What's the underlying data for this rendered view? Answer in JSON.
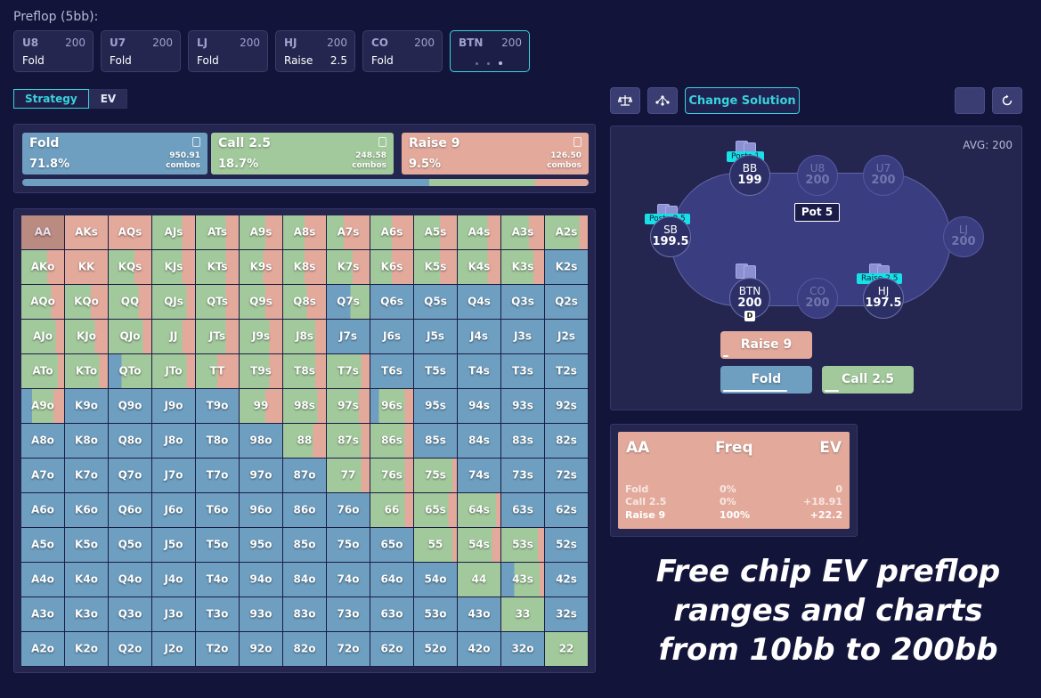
{
  "header": {
    "action_title": "Preflop (5bb):",
    "positions": [
      {
        "name": "U8",
        "stack": "200",
        "action": "Fold",
        "amount": ""
      },
      {
        "name": "U7",
        "stack": "200",
        "action": "Fold",
        "amount": ""
      },
      {
        "name": "LJ",
        "stack": "200",
        "action": "Fold",
        "amount": ""
      },
      {
        "name": "HJ",
        "stack": "200",
        "action": "Raise",
        "amount": "2.5"
      },
      {
        "name": "CO",
        "stack": "200",
        "action": "Fold",
        "amount": ""
      },
      {
        "name": "BTN",
        "stack": "200",
        "action": "",
        "amount": "",
        "active": true
      }
    ]
  },
  "tabs": {
    "strategy": "Strategy",
    "ev": "EV"
  },
  "colors": {
    "fold": "#6e9fc1",
    "call": "#a2c99c",
    "raise": "#e3aa9c",
    "accent": "#38d3dc",
    "background": "#13143a"
  },
  "summary": [
    {
      "label": "Fold",
      "pct": "71.8%",
      "combos": "950.91",
      "combos_label": "combos",
      "color": "#6e9fc1"
    },
    {
      "label": "Call 2.5",
      "pct": "18.7%",
      "combos": "248.58",
      "combos_label": "combos",
      "color": "#a2c99c"
    },
    {
      "label": "Raise 9",
      "pct": "9.5%",
      "combos": "126.50",
      "combos_label": "combos",
      "color": "#e3aa9c"
    }
  ],
  "summary_bar": {
    "fold": 71.8,
    "call": 18.7,
    "raise": 9.5
  },
  "grid": {
    "rows": [
      [
        "AA",
        "AKs",
        "AQs",
        "AJs",
        "ATs",
        "A9s",
        "A8s",
        "A7s",
        "A6s",
        "A5s",
        "A4s",
        "A3s",
        "A2s"
      ],
      [
        "AKo",
        "KK",
        "KQs",
        "KJs",
        "KTs",
        "K9s",
        "K8s",
        "K7s",
        "K6s",
        "K5s",
        "K4s",
        "K3s",
        "K2s"
      ],
      [
        "AQo",
        "KQo",
        "QQ",
        "QJs",
        "QTs",
        "Q9s",
        "Q8s",
        "Q7s",
        "Q6s",
        "Q5s",
        "Q4s",
        "Q3s",
        "Q2s"
      ],
      [
        "AJo",
        "KJo",
        "QJo",
        "JJ",
        "JTs",
        "J9s",
        "J8s",
        "J7s",
        "J6s",
        "J5s",
        "J4s",
        "J3s",
        "J2s"
      ],
      [
        "ATo",
        "KTo",
        "QTo",
        "JTo",
        "TT",
        "T9s",
        "T8s",
        "T7s",
        "T6s",
        "T5s",
        "T4s",
        "T3s",
        "T2s"
      ],
      [
        "A9o",
        "K9o",
        "Q9o",
        "J9o",
        "T9o",
        "99",
        "98s",
        "97s",
        "96s",
        "95s",
        "94s",
        "93s",
        "92s"
      ],
      [
        "A8o",
        "K8o",
        "Q8o",
        "J8o",
        "T8o",
        "98o",
        "88",
        "87s",
        "86s",
        "85s",
        "84s",
        "83s",
        "82s"
      ],
      [
        "A7o",
        "K7o",
        "Q7o",
        "J7o",
        "T7o",
        "97o",
        "87o",
        "77",
        "76s",
        "75s",
        "74s",
        "73s",
        "72s"
      ],
      [
        "A6o",
        "K6o",
        "Q6o",
        "J6o",
        "T6o",
        "96o",
        "86o",
        "76o",
        "66",
        "65s",
        "64s",
        "63s",
        "62s"
      ],
      [
        "A5o",
        "K5o",
        "Q5o",
        "J5o",
        "T5o",
        "95o",
        "85o",
        "75o",
        "65o",
        "55",
        "54s",
        "53s",
        "52s"
      ],
      [
        "A4o",
        "K4o",
        "Q4o",
        "J4o",
        "T4o",
        "94o",
        "84o",
        "74o",
        "64o",
        "54o",
        "44",
        "43s",
        "42s"
      ],
      [
        "A3o",
        "K3o",
        "Q3o",
        "J3o",
        "T3o",
        "93o",
        "83o",
        "73o",
        "63o",
        "53o",
        "43o",
        "33",
        "32s"
      ],
      [
        "A2o",
        "K2o",
        "Q2o",
        "J2o",
        "T2o",
        "92o",
        "82o",
        "72o",
        "62o",
        "52o",
        "42o",
        "32o",
        "22"
      ]
    ],
    "strategy": {
      "AA": [
        0,
        0,
        1
      ],
      "AKs": [
        0,
        0,
        1
      ],
      "AQs": [
        0,
        0,
        1
      ],
      "AJs": [
        0,
        0.7,
        0.3
      ],
      "ATs": [
        0,
        0.7,
        0.3
      ],
      "A9s": [
        0,
        0.6,
        0.4
      ],
      "A8s": [
        0,
        0.5,
        0.5
      ],
      "A7s": [
        0,
        0.4,
        0.6
      ],
      "A6s": [
        0,
        0.5,
        0.5
      ],
      "A5s": [
        0,
        0.6,
        0.4
      ],
      "A4s": [
        0,
        0.7,
        0.3
      ],
      "A3s": [
        0,
        0.65,
        0.35
      ],
      "A2s": [
        0,
        0.8,
        0.2
      ],
      "AKo": [
        0,
        0.6,
        0.4
      ],
      "KK": [
        0,
        0,
        1
      ],
      "KQs": [
        0,
        0.6,
        0.4
      ],
      "KJs": [
        0,
        0.7,
        0.3
      ],
      "KTs": [
        0,
        0.7,
        0.3
      ],
      "K9s": [
        0,
        0.55,
        0.45
      ],
      "K8s": [
        0,
        0.5,
        0.5
      ],
      "K7s": [
        0,
        0.6,
        0.4
      ],
      "K6s": [
        0,
        0.5,
        0.5
      ],
      "K5s": [
        0,
        0.6,
        0.4
      ],
      "K4s": [
        0,
        0.7,
        0.3
      ],
      "K3s": [
        0,
        0.75,
        0.25
      ],
      "K2s": [
        1,
        0,
        0
      ],
      "AQo": [
        0,
        0.7,
        0.3
      ],
      "KQo": [
        0,
        0.6,
        0.4
      ],
      "QQ": [
        0,
        0.7,
        0.3
      ],
      "QJs": [
        0,
        0.8,
        0.2
      ],
      "QTs": [
        0,
        0.7,
        0.3
      ],
      "Q9s": [
        0,
        0.6,
        0.4
      ],
      "Q8s": [
        0,
        0.55,
        0.45
      ],
      "Q7s": [
        0.55,
        0.45,
        0
      ],
      "Q6s": [
        1,
        0,
        0
      ],
      "Q5s": [
        1,
        0,
        0
      ],
      "Q4s": [
        1,
        0,
        0
      ],
      "Q3s": [
        1,
        0,
        0
      ],
      "Q2s": [
        1,
        0,
        0
      ],
      "AJo": [
        0,
        0.8,
        0.2
      ],
      "KJo": [
        0,
        0.7,
        0.3
      ],
      "QJo": [
        0,
        0.8,
        0.2
      ],
      "JJ": [
        0,
        0.7,
        0.3
      ],
      "JTs": [
        0,
        0.7,
        0.3
      ],
      "J9s": [
        0,
        0.7,
        0.3
      ],
      "J8s": [
        0,
        0.75,
        0.25
      ],
      "J7s": [
        1,
        0,
        0
      ],
      "J6s": [
        1,
        0,
        0
      ],
      "J5s": [
        1,
        0,
        0
      ],
      "J4s": [
        1,
        0,
        0
      ],
      "J3s": [
        1,
        0,
        0
      ],
      "J2s": [
        1,
        0,
        0
      ],
      "ATo": [
        0,
        0.85,
        0.15
      ],
      "KTo": [
        0,
        0.8,
        0.2
      ],
      "QTo": [
        0.3,
        0.7,
        0
      ],
      "JTo": [
        0,
        0.8,
        0.2
      ],
      "TT": [
        0,
        0.5,
        0.5
      ],
      "T9s": [
        0,
        0.7,
        0.3
      ],
      "T8s": [
        0,
        0.75,
        0.25
      ],
      "T7s": [
        0,
        0.8,
        0.2
      ],
      "T6s": [
        1,
        0,
        0
      ],
      "T5s": [
        1,
        0,
        0
      ],
      "T4s": [
        1,
        0,
        0
      ],
      "T3s": [
        1,
        0,
        0
      ],
      "T2s": [
        1,
        0,
        0
      ],
      "A9o": [
        0.25,
        0.5,
        0.25
      ],
      "K9o": [
        1,
        0,
        0
      ],
      "Q9o": [
        1,
        0,
        0
      ],
      "J9o": [
        1,
        0,
        0
      ],
      "T9o": [
        1,
        0,
        0
      ],
      "99": [
        0,
        0.6,
        0.4
      ],
      "98s": [
        0,
        0.8,
        0.2
      ],
      "97s": [
        0,
        0.75,
        0.25
      ],
      "96s": [
        0.2,
        0.6,
        0.2
      ],
      "95s": [
        1,
        0,
        0
      ],
      "94s": [
        1,
        0,
        0
      ],
      "93s": [
        1,
        0,
        0
      ],
      "92s": [
        1,
        0,
        0
      ],
      "A8o": [
        1,
        0,
        0
      ],
      "K8o": [
        1,
        0,
        0
      ],
      "Q8o": [
        1,
        0,
        0
      ],
      "J8o": [
        1,
        0,
        0
      ],
      "T8o": [
        1,
        0,
        0
      ],
      "98o": [
        1,
        0,
        0
      ],
      "88": [
        0,
        0.7,
        0.3
      ],
      "87s": [
        0,
        0.8,
        0.2
      ],
      "86s": [
        0,
        0.8,
        0.2
      ],
      "85s": [
        1,
        0,
        0
      ],
      "84s": [
        1,
        0,
        0
      ],
      "83s": [
        1,
        0,
        0
      ],
      "82s": [
        1,
        0,
        0
      ],
      "A7o": [
        1,
        0,
        0
      ],
      "K7o": [
        1,
        0,
        0
      ],
      "Q7o": [
        1,
        0,
        0
      ],
      "J7o": [
        1,
        0,
        0
      ],
      "T7o": [
        1,
        0,
        0
      ],
      "97o": [
        1,
        0,
        0
      ],
      "87o": [
        1,
        0,
        0
      ],
      "77": [
        0,
        0.8,
        0.2
      ],
      "76s": [
        0,
        0.8,
        0.2
      ],
      "75s": [
        0,
        0.9,
        0.1
      ],
      "74s": [
        1,
        0,
        0
      ],
      "73s": [
        1,
        0,
        0
      ],
      "72s": [
        1,
        0,
        0
      ],
      "A6o": [
        1,
        0,
        0
      ],
      "K6o": [
        1,
        0,
        0
      ],
      "Q6o": [
        1,
        0,
        0
      ],
      "J6o": [
        1,
        0,
        0
      ],
      "T6o": [
        1,
        0,
        0
      ],
      "96o": [
        1,
        0,
        0
      ],
      "86o": [
        1,
        0,
        0
      ],
      "76o": [
        1,
        0,
        0
      ],
      "66": [
        0,
        0.8,
        0.2
      ],
      "65s": [
        0,
        0.8,
        0.2
      ],
      "64s": [
        0,
        0.9,
        0.1
      ],
      "63s": [
        1,
        0,
        0
      ],
      "62s": [
        1,
        0,
        0
      ],
      "A5o": [
        1,
        0,
        0
      ],
      "K5o": [
        1,
        0,
        0
      ],
      "Q5o": [
        1,
        0,
        0
      ],
      "J5o": [
        1,
        0,
        0
      ],
      "T5o": [
        1,
        0,
        0
      ],
      "95o": [
        1,
        0,
        0
      ],
      "85o": [
        1,
        0,
        0
      ],
      "75o": [
        1,
        0,
        0
      ],
      "65o": [
        1,
        0,
        0
      ],
      "55": [
        0,
        0.9,
        0.1
      ],
      "54s": [
        0,
        0.8,
        0.2
      ],
      "53s": [
        0,
        0.85,
        0.15
      ],
      "52s": [
        1,
        0,
        0
      ],
      "A4o": [
        1,
        0,
        0
      ],
      "K4o": [
        1,
        0,
        0
      ],
      "Q4o": [
        1,
        0,
        0
      ],
      "J4o": [
        1,
        0,
        0
      ],
      "T4o": [
        1,
        0,
        0
      ],
      "94o": [
        1,
        0,
        0
      ],
      "84o": [
        1,
        0,
        0
      ],
      "74o": [
        1,
        0,
        0
      ],
      "64o": [
        1,
        0,
        0
      ],
      "54o": [
        1,
        0,
        0
      ],
      "44": [
        0,
        1,
        0
      ],
      "43s": [
        0.3,
        0.6,
        0.1
      ],
      "42s": [
        1,
        0,
        0
      ],
      "A3o": [
        1,
        0,
        0
      ],
      "K3o": [
        1,
        0,
        0
      ],
      "Q3o": [
        1,
        0,
        0
      ],
      "J3o": [
        1,
        0,
        0
      ],
      "T3o": [
        1,
        0,
        0
      ],
      "93o": [
        1,
        0,
        0
      ],
      "83o": [
        1,
        0,
        0
      ],
      "73o": [
        1,
        0,
        0
      ],
      "63o": [
        1,
        0,
        0
      ],
      "53o": [
        1,
        0,
        0
      ],
      "43o": [
        1,
        0,
        0
      ],
      "33": [
        0,
        1,
        0
      ],
      "32s": [
        1,
        0,
        0
      ],
      "A2o": [
        1,
        0,
        0
      ],
      "K2o": [
        1,
        0,
        0
      ],
      "Q2o": [
        1,
        0,
        0
      ],
      "J2o": [
        1,
        0,
        0
      ],
      "T2o": [
        1,
        0,
        0
      ],
      "92o": [
        1,
        0,
        0
      ],
      "82o": [
        1,
        0,
        0
      ],
      "72o": [
        1,
        0,
        0
      ],
      "62o": [
        1,
        0,
        0
      ],
      "52o": [
        1,
        0,
        0
      ],
      "42o": [
        1,
        0,
        0
      ],
      "32o": [
        1,
        0,
        0
      ],
      "22": [
        0,
        1,
        0
      ]
    },
    "selected": "AA"
  },
  "toolbar": {
    "change_solution": "Change Solution",
    "icons": [
      "scale-icon",
      "tree-icon",
      "refresh-icon"
    ]
  },
  "table": {
    "avg_label": "AVG: 200",
    "pot_label": "Pot 5",
    "seats": [
      {
        "id": "bb",
        "name": "BB",
        "stack": "199",
        "dim": false,
        "badge": "Posts 1"
      },
      {
        "id": "u8",
        "name": "U8",
        "stack": "200",
        "dim": true
      },
      {
        "id": "u7",
        "name": "U7",
        "stack": "200",
        "dim": true
      },
      {
        "id": "sb",
        "name": "SB",
        "stack": "199.5",
        "dim": false,
        "badge": "Posts 0.5"
      },
      {
        "id": "lj",
        "name": "LJ",
        "stack": "200",
        "dim": true
      },
      {
        "id": "btn",
        "name": "BTN",
        "stack": "200",
        "dim": false
      },
      {
        "id": "co",
        "name": "CO",
        "stack": "200",
        "dim": true
      },
      {
        "id": "hj",
        "name": "HJ",
        "stack": "197.5",
        "dim": false,
        "badge": "Raise 2.5"
      }
    ],
    "dealer": "D",
    "actions": [
      {
        "label": "Raise 9",
        "color": "#e3aa9c"
      },
      {
        "label": "Fold",
        "color": "#6e9fc1"
      },
      {
        "label": "Call 2.5",
        "color": "#a2c99c"
      }
    ]
  },
  "hand_detail": {
    "hand": "AA",
    "freq_header": "Freq",
    "ev_header": "EV",
    "rows": [
      {
        "action": "Fold",
        "freq": "0%",
        "ev": "0"
      },
      {
        "action": "Call 2.5",
        "freq": "0%",
        "ev": "+18.91"
      },
      {
        "action": "Raise 9",
        "freq": "100%",
        "ev": "+22.2"
      }
    ]
  },
  "promo": {
    "line1": "Free chip EV preflop",
    "line2": "ranges and charts",
    "line3": "from 10bb to 200bb"
  }
}
